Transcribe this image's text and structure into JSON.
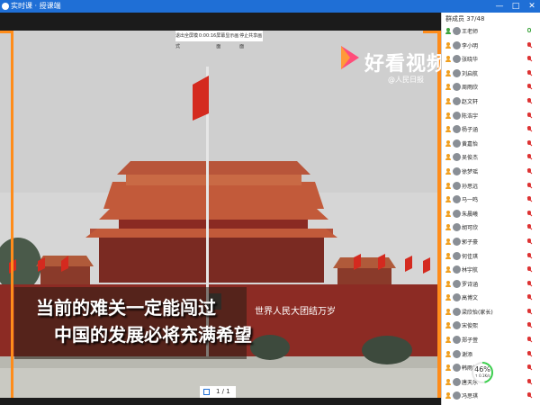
{
  "window": {
    "title": "实时课 · 授课端",
    "controls": [
      "—",
      "□",
      "✕"
    ]
  },
  "video": {
    "toolbar": [
      "退出全屏模式",
      "0:00:16",
      "屏幕显示画面",
      "停止共享画面"
    ],
    "watermark": {
      "brand": "好看视频",
      "sub": "@人民日报"
    },
    "captions": [
      "当前的难关一定能闯过",
      "中国的发展必将充满希望"
    ],
    "gate_slogan": "世界人民大团结万岁",
    "page_indicator": "1 / 1"
  },
  "sidebar": {
    "header": "群成员 37/48",
    "members": [
      {
        "name": "王老师",
        "role": "teacher",
        "mic": "on"
      },
      {
        "name": "李小明",
        "role": "student",
        "mic": "muted"
      },
      {
        "name": "张晓华",
        "role": "student",
        "mic": "muted"
      },
      {
        "name": "刘启航",
        "role": "student",
        "mic": "muted"
      },
      {
        "name": "周雨欣",
        "role": "student",
        "mic": "muted"
      },
      {
        "name": "赵文轩",
        "role": "student",
        "mic": "muted"
      },
      {
        "name": "陈浩宇",
        "role": "student",
        "mic": "muted"
      },
      {
        "name": "杨子涵",
        "role": "student",
        "mic": "muted"
      },
      {
        "name": "黄嘉怡",
        "role": "student",
        "mic": "muted"
      },
      {
        "name": "吴俊杰",
        "role": "student",
        "mic": "muted"
      },
      {
        "name": "徐梦瑶",
        "role": "student",
        "mic": "muted"
      },
      {
        "name": "孙思远",
        "role": "student",
        "mic": "muted"
      },
      {
        "name": "马一鸣",
        "role": "student",
        "mic": "muted"
      },
      {
        "name": "朱晨曦",
        "role": "student",
        "mic": "muted"
      },
      {
        "name": "胡可欣",
        "role": "student",
        "mic": "muted"
      },
      {
        "name": "郭子豪",
        "role": "student",
        "mic": "muted"
      },
      {
        "name": "何佳琪",
        "role": "student",
        "mic": "muted"
      },
      {
        "name": "林宇航",
        "role": "student",
        "mic": "muted"
      },
      {
        "name": "罗诗涵",
        "role": "student",
        "mic": "muted"
      },
      {
        "name": "高博文",
        "role": "student",
        "mic": "muted"
      },
      {
        "name": "梁欣怡(家长)",
        "role": "student",
        "mic": "muted"
      },
      {
        "name": "宋俊熙",
        "role": "student",
        "mic": "muted"
      },
      {
        "name": "郑子萱",
        "role": "student",
        "mic": "muted"
      },
      {
        "name": "谢添",
        "role": "student",
        "mic": "muted"
      },
      {
        "name": "韩雨桐",
        "role": "student",
        "mic": "muted"
      },
      {
        "name": "唐天乐",
        "role": "student",
        "mic": "muted"
      },
      {
        "name": "冯思琪",
        "role": "student",
        "mic": "muted"
      },
      {
        "name": "邓乐天",
        "role": "student",
        "mic": "muted"
      }
    ],
    "progress": {
      "percent_label": "46%",
      "percent": 46,
      "speed": "↑ 0.1K/s"
    }
  },
  "colors": {
    "accent": "#1f6fd6",
    "frame": "#ff8c1a",
    "mic_muted": "#dd3333",
    "mic_on": "#3ca33c"
  }
}
